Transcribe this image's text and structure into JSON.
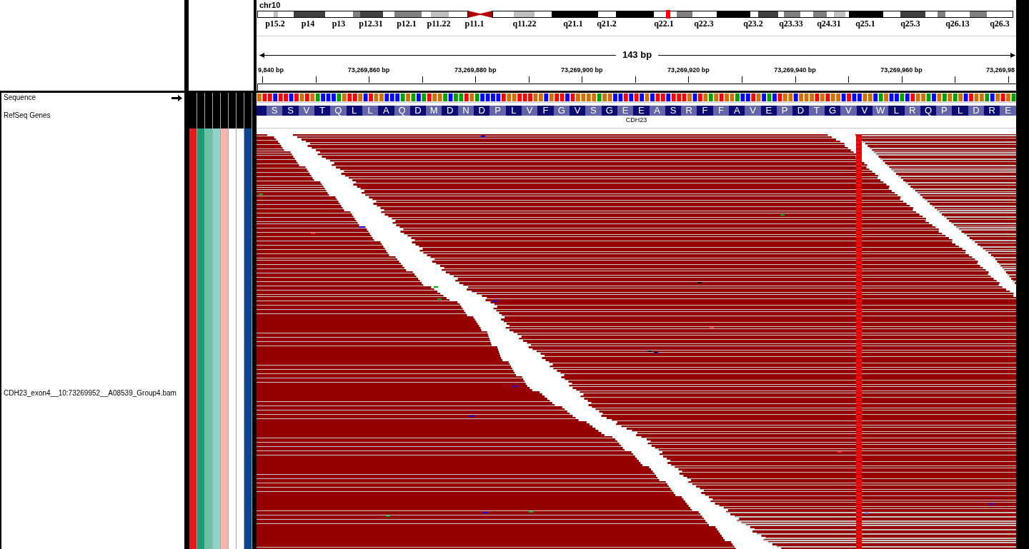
{
  "header": {
    "chromosome": "chr10",
    "cytobands": [
      "p15.2",
      "p14",
      "p13",
      "p12.31",
      "p12.1",
      "p11.22",
      "p11.1",
      "q11.22",
      "q21.1",
      "q21.2",
      "q22.1",
      "q22.3",
      "q23.2",
      "q23.33",
      "q24.31",
      "q25.1",
      "q25.3",
      "q26.13",
      "q26.3"
    ],
    "span": "143 bp",
    "ruler_labels": [
      "9,840 bp",
      "73,269,860 bp",
      "73,269,880 bp",
      "73,269,900 bp",
      "73,269,920 bp",
      "73,269,940 bp",
      "73,269,960 bp",
      "73,269,98"
    ]
  },
  "tracks": [
    {
      "kind": "sequence",
      "name": "Sequence"
    },
    {
      "kind": "gene",
      "name": "RefSeq Genes",
      "gene": "CDH23",
      "amino_acids": [
        "S",
        "S",
        "V",
        "T",
        "Q",
        "L",
        "L",
        "A",
        "Q",
        "D",
        "M",
        "D",
        "N",
        "D",
        "P",
        "L",
        "V",
        "F",
        "G",
        "V",
        "S",
        "G",
        "E",
        "E",
        "A",
        "S",
        "R",
        "F",
        "F",
        "A",
        "V",
        "E",
        "P",
        "D",
        "T",
        "G",
        "V",
        "V",
        "W",
        "L",
        "R",
        "Q",
        "P",
        "L",
        "D",
        "R",
        "E"
      ]
    },
    {
      "kind": "alignment",
      "name": "CDH23_exon4__10:73269952__A08539_Group4.bam"
    }
  ],
  "attributes": [
    {
      "color": "#e41a1c"
    },
    {
      "color": "#1b9e77"
    },
    {
      "color": "#66c2a5"
    },
    {
      "color": "#8dd3c7"
    },
    {
      "color": "#fbb4ae"
    },
    {
      "color": "#ffffff"
    },
    {
      "color": "#ffffff"
    },
    {
      "color": "#0b4591"
    }
  ]
}
